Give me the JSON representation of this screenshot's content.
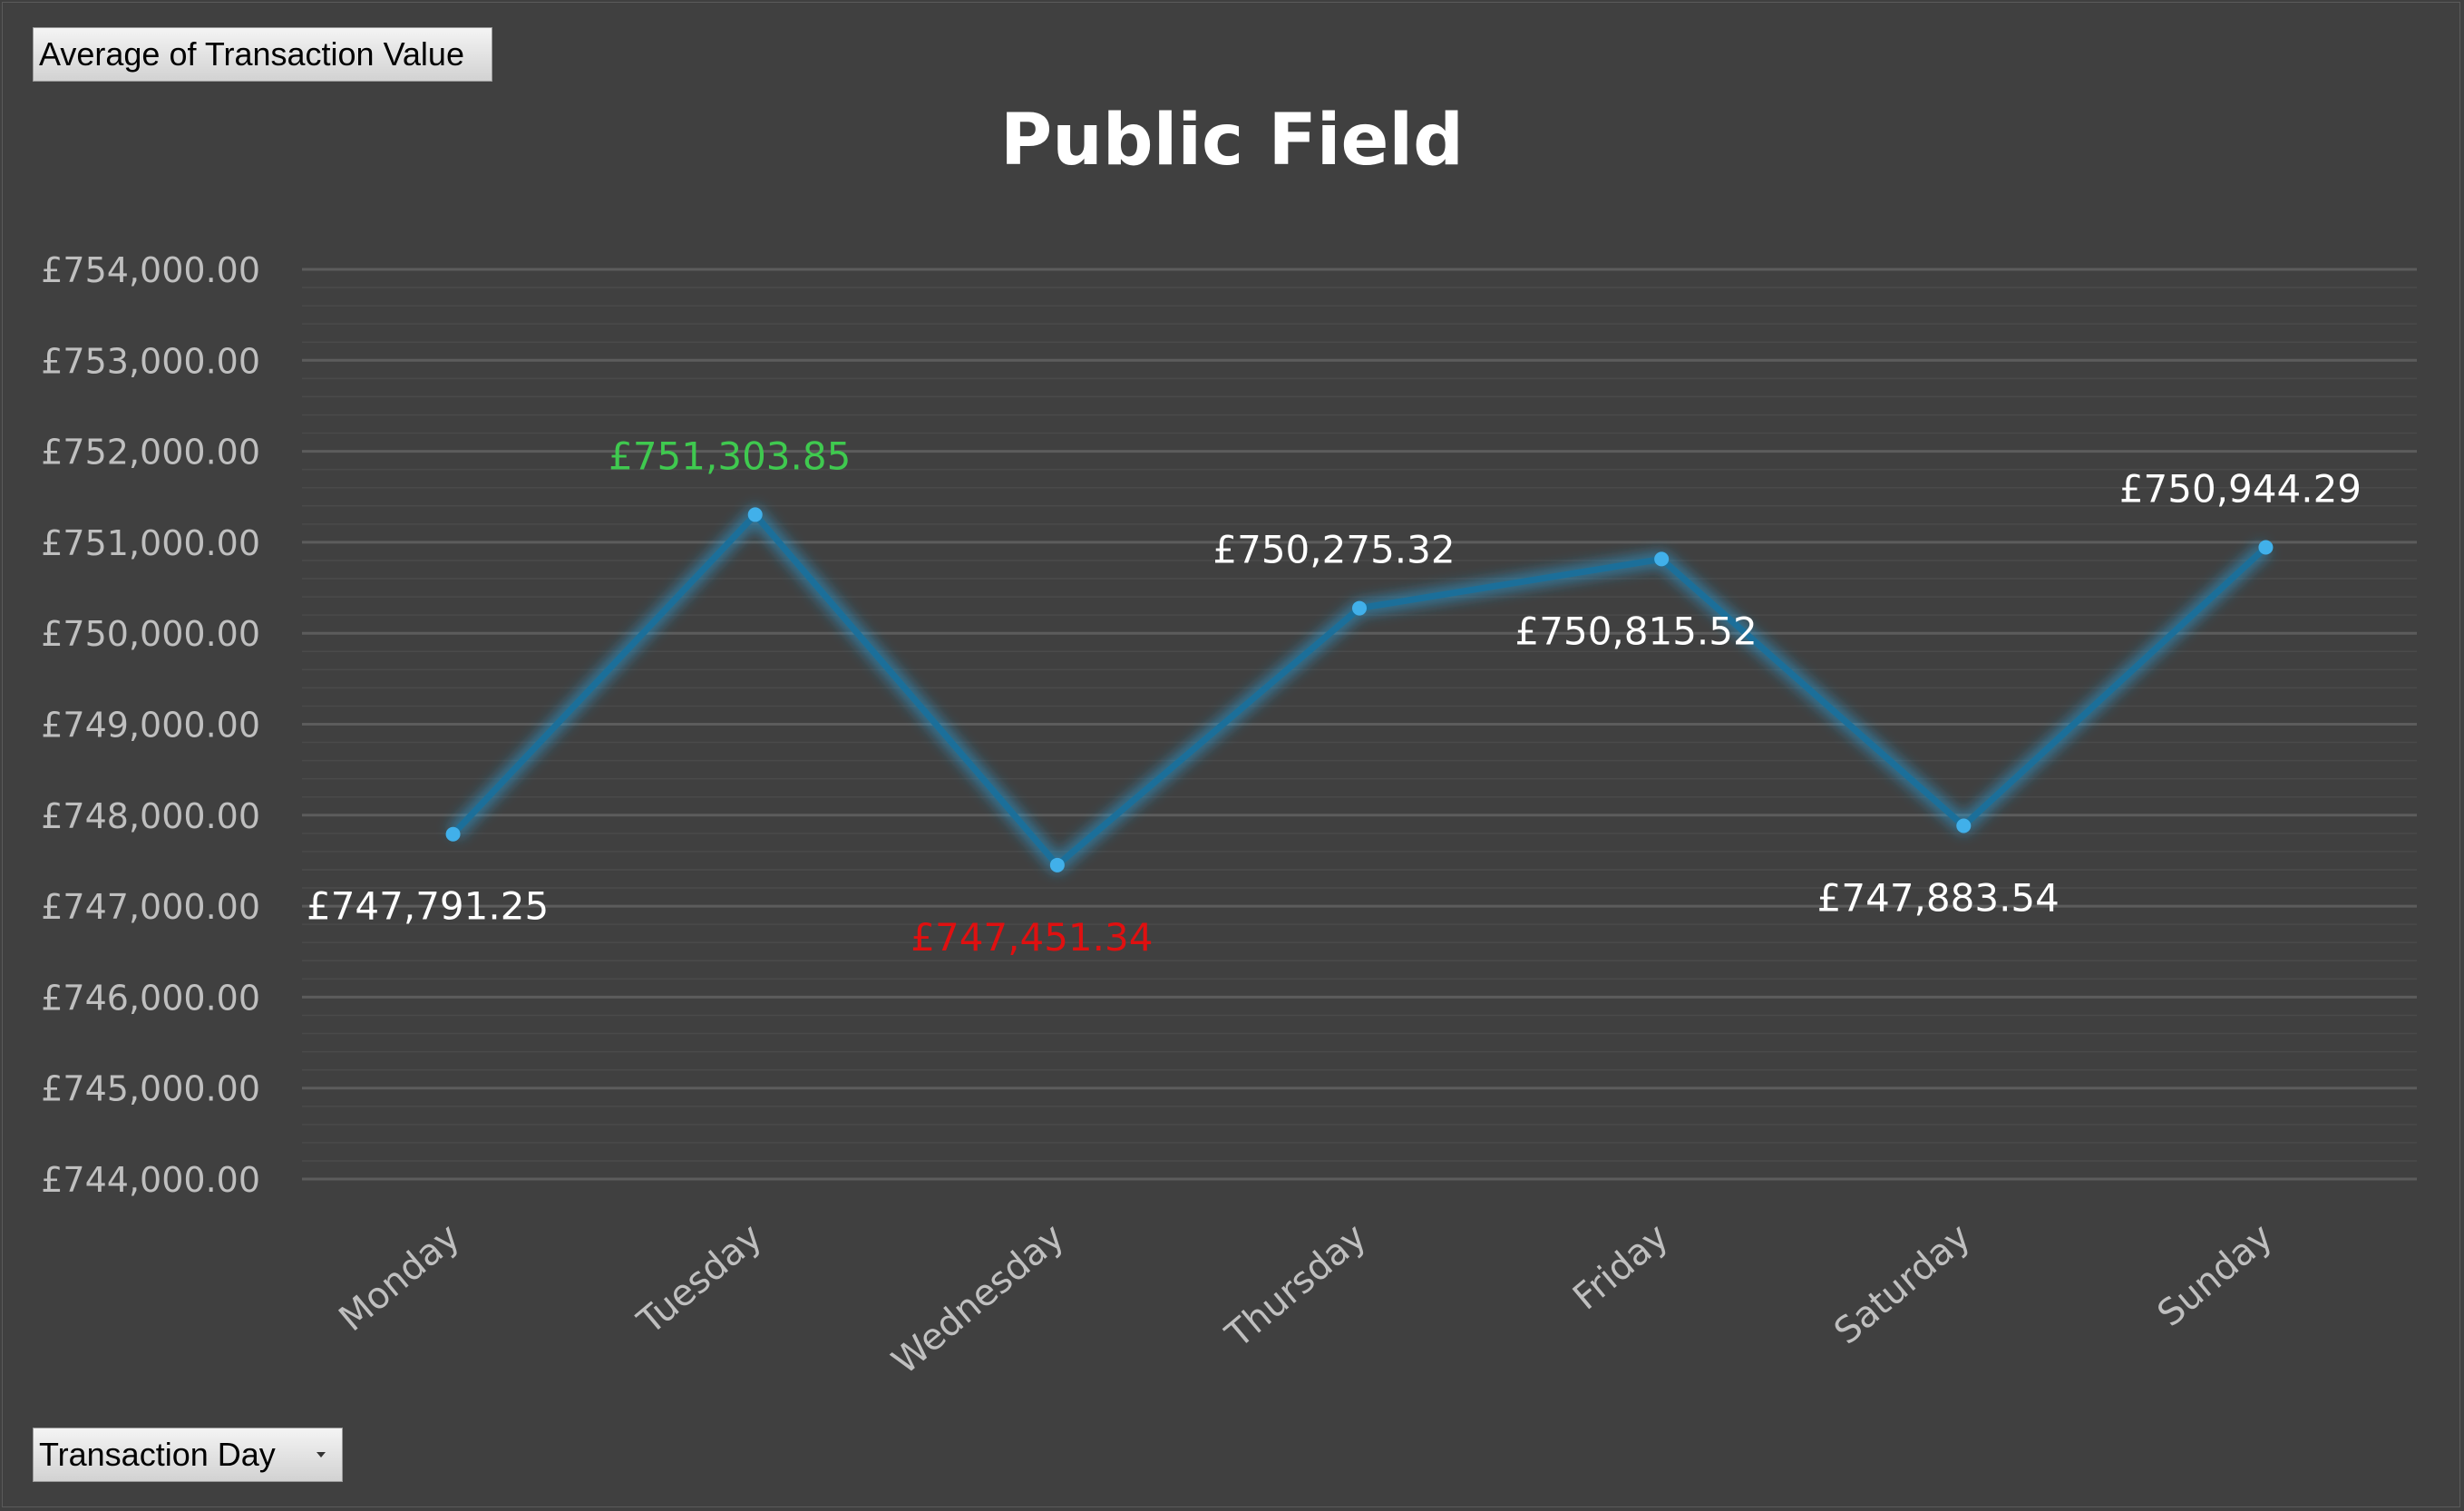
{
  "pivot": {
    "value_field_label": "Average of Transaction Value",
    "axis_field_label": "Transaction Day"
  },
  "chart_data": {
    "type": "line",
    "title": "Public Field",
    "xlabel": "",
    "ylabel": "",
    "categories": [
      "Monday",
      "Tuesday",
      "Wednesday",
      "Thursday",
      "Friday",
      "Saturday",
      "Sunday"
    ],
    "series": [
      {
        "values": [
          747791.25,
          751303.85,
          747451.34,
          750275.32,
          750815.52,
          747883.54,
          750944.29
        ],
        "data_labels": [
          "£747,791.25",
          "£751,303.85",
          "£747,451.34",
          "£750,275.32",
          "£750,815.52",
          "£747,883.54",
          "£750,944.29"
        ],
        "data_label_positions": [
          "below",
          "above",
          "below",
          "above",
          "below",
          "below",
          "above"
        ]
      }
    ],
    "ylim": [
      744000,
      754000
    ],
    "y_ticks": [
      754000,
      753000,
      752000,
      751000,
      750000,
      749000,
      748000,
      747000,
      746000,
      745000,
      744000
    ],
    "y_tick_labels": [
      "£754,000.00",
      "£753,000.00",
      "£752,000.00",
      "£751,000.00",
      "£750,000.00",
      "£749,000.00",
      "£748,000.00",
      "£747,000.00",
      "£746,000.00",
      "£745,000.00",
      "£744,000.00"
    ],
    "grid": true,
    "minor_grid": true,
    "legend": "none",
    "highlight": {
      "max_label_color": "#3fc94f",
      "min_label_color": "#e01010"
    },
    "colors": {
      "background": "#404040",
      "line": "#1b6f9a",
      "line_glow": "#2a9fd8",
      "marker": "#41b0ea",
      "label": "#ffffff",
      "tick_label": "#bfbfbf",
      "major_grid": "#5c5c5c",
      "minor_grid": "#4a4a4a"
    }
  }
}
